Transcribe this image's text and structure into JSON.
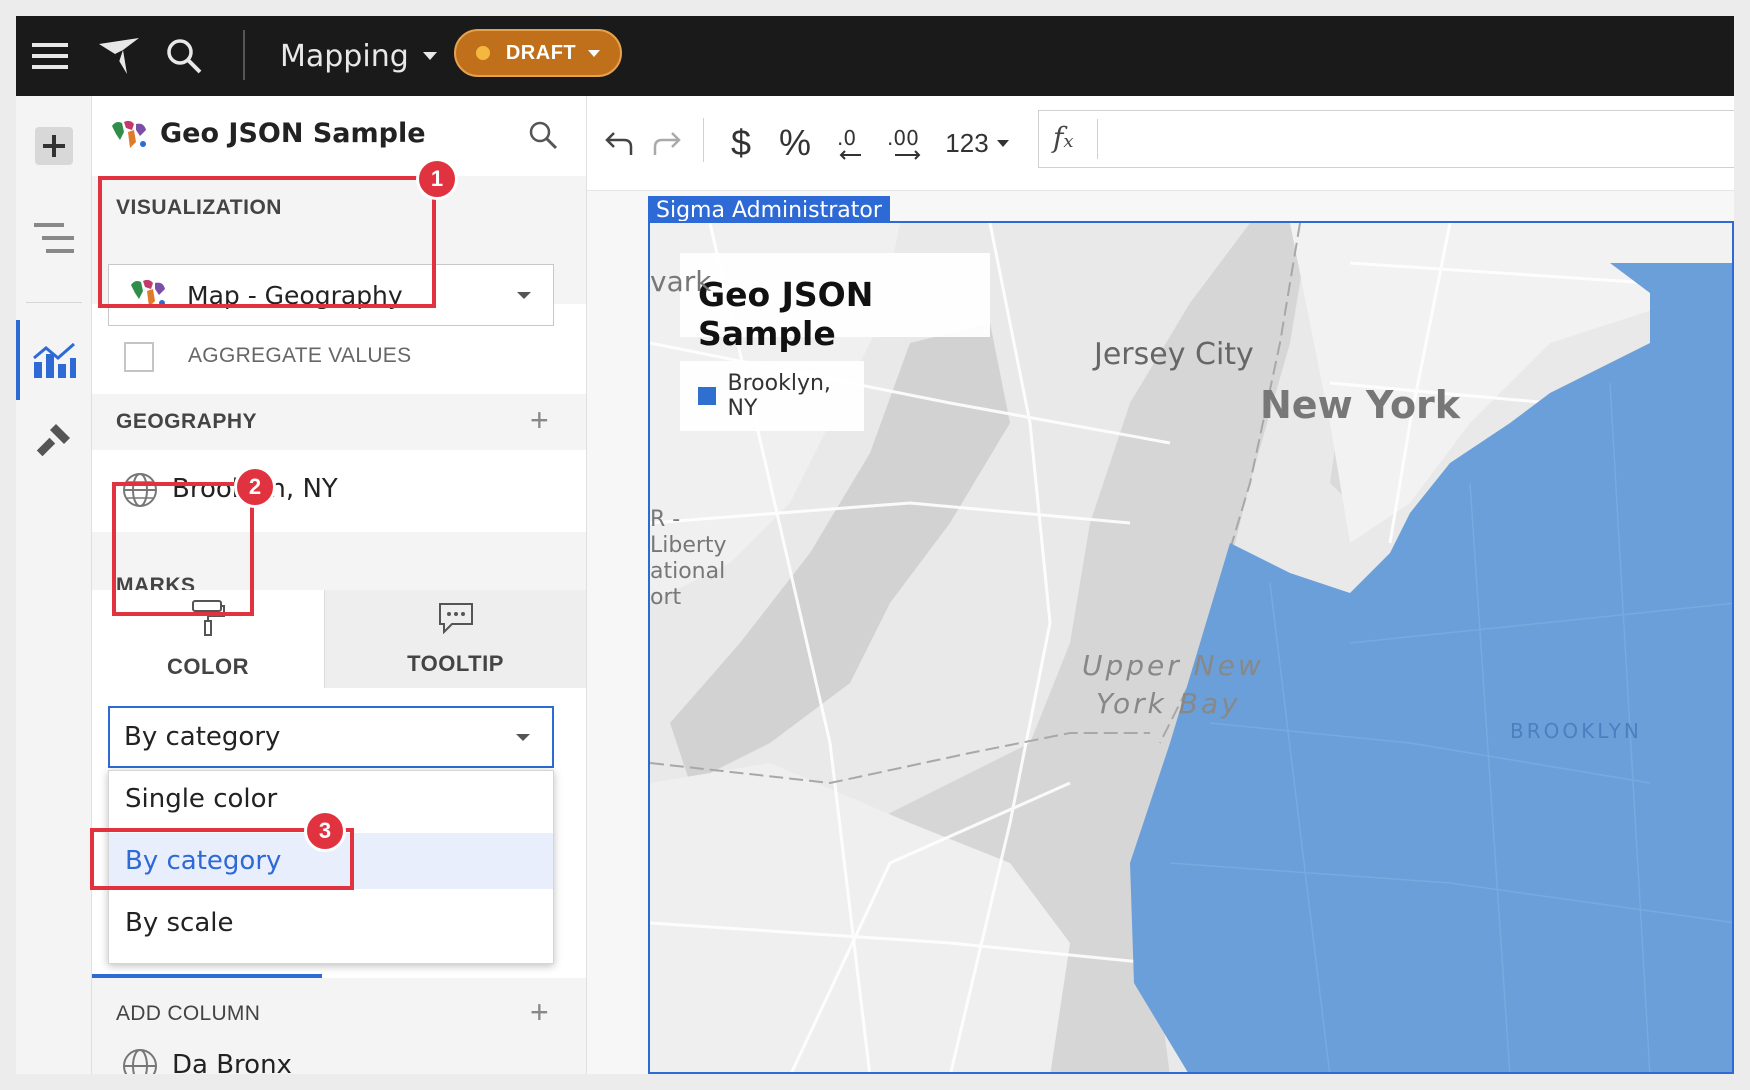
{
  "topbar": {
    "workbook_title": "Mapping",
    "status_label": "DRAFT"
  },
  "panel": {
    "element_title": "Geo JSON Sample",
    "visualization": {
      "section_label": "VISUALIZATION",
      "selected": "Map - Geography",
      "aggregate_label": "AGGREGATE VALUES"
    },
    "geography": {
      "section_label": "GEOGRAPHY",
      "item": "Brooklyn, NY"
    },
    "marks": {
      "section_label": "MARKS",
      "tabs": [
        {
          "label": "COLOR",
          "active": true
        },
        {
          "label": "TOOLTIP",
          "active": false
        }
      ],
      "color_mode_value": "By category",
      "options": [
        {
          "label": "Single color",
          "selected": false
        },
        {
          "label": "By category",
          "selected": true
        },
        {
          "label": "By scale",
          "selected": false
        }
      ]
    },
    "add_column": {
      "label": "ADD COLUMN",
      "item": "Da Bronx"
    }
  },
  "annotations": [
    "1",
    "2",
    "3"
  ],
  "toolbar": {
    "number_format_label": "123"
  },
  "canvas": {
    "owner_tag": "Sigma Administrator",
    "chart_title": "Geo JSON Sample",
    "legend_entries": [
      {
        "label": "Brooklyn, NY",
        "color": "#2f6fd0"
      }
    ],
    "map_labels": {
      "jersey_city": "Jersey City",
      "new_york": "New York",
      "bay_line1": "Upper New",
      "bay_line2": "York Bay",
      "brooklyn": "BROOKLYN",
      "newark_partial": "vark",
      "airport_partial": [
        "R -",
        "Liberty",
        "ational",
        "ort"
      ]
    }
  },
  "colors": {
    "accent": "#2e6ad6",
    "draft": "#c0701a",
    "annotation": "#e0333f",
    "brooklyn_fill": "#6b9fda"
  }
}
